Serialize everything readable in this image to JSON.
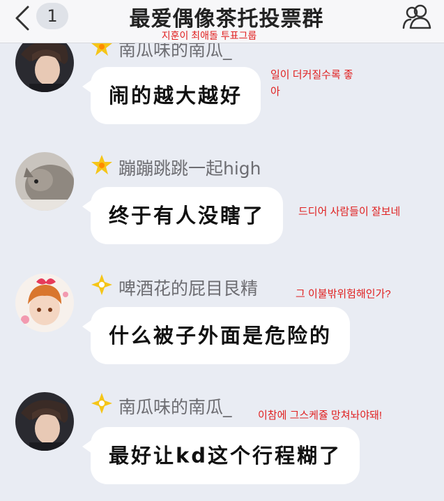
{
  "header": {
    "back_icon": "chevron-left-icon",
    "unread_count": "1",
    "title": "最爱偶像茶托投票群",
    "members_icon": "group-members-icon",
    "subtitle_translation": "지훈이 최애돌 투표그룹"
  },
  "colors": {
    "background": "#e9ecf3",
    "bubble": "#ffffff",
    "annotation": "#e02020",
    "badge": "#f5c518"
  },
  "messages": [
    {
      "sender": "南瓜味的南瓜_",
      "badge_icon": "star-badge-icon",
      "text": "闹的越大越好",
      "annotation": [
        "일이 더커질수록 좋",
        "아"
      ]
    },
    {
      "sender": "蹦蹦跳跳一起high",
      "badge_icon": "star-badge-icon",
      "text": "终于有人没瞎了",
      "annotation": [
        "드디어 사람들이 잘보네"
      ]
    },
    {
      "sender": "啤酒花的屁目艮精",
      "badge_icon": "diamond-badge-icon",
      "text": "什么被子外面是危险的",
      "annotation": [
        "그 이불밖위험해인가?"
      ]
    },
    {
      "sender": "南瓜味的南瓜_",
      "badge_icon": "diamond-badge-icon",
      "text": "最好让kd这个行程糊了",
      "annotation": [
        "이참에 그스케쥴 망쳐놔야돼!"
      ]
    }
  ]
}
